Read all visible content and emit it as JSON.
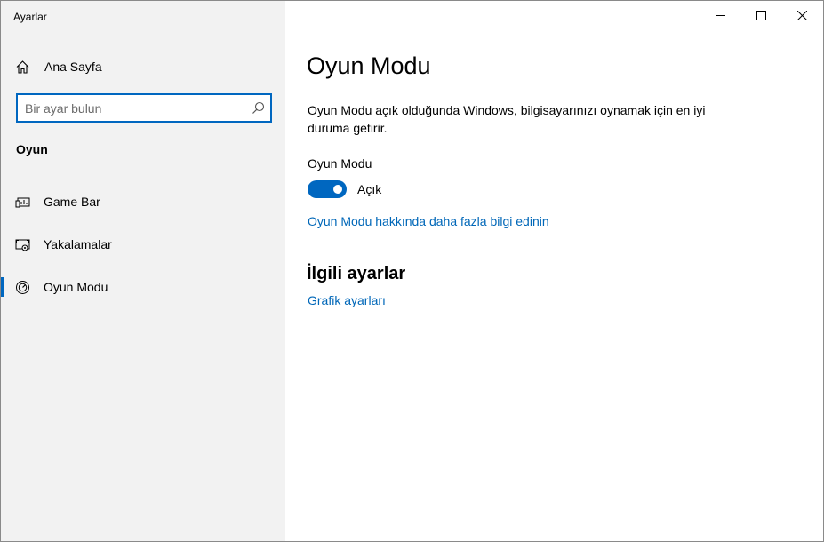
{
  "window": {
    "title": "Ayarlar",
    "controls": {
      "minimize": "minimize-icon",
      "maximize": "maximize-icon",
      "close": "close-icon"
    }
  },
  "sidebar": {
    "home_label": "Ana Sayfa",
    "search": {
      "placeholder": "Bir ayar bulun",
      "value": ""
    },
    "section_title": "Oyun",
    "items": [
      {
        "label": "Game Bar",
        "icon": "game-bar-icon",
        "active": false
      },
      {
        "label": "Yakalamalar",
        "icon": "captures-icon",
        "active": false
      },
      {
        "label": "Oyun Modu",
        "icon": "game-mode-icon",
        "active": true
      }
    ]
  },
  "main": {
    "title": "Oyun Modu",
    "description": "Oyun Modu açık olduğunda Windows, bilgisayarınızı oynamak için en iyi duruma getirir.",
    "setting_label": "Oyun Modu",
    "toggle": {
      "on": true,
      "state_label": "Açık"
    },
    "learn_more_link": "Oyun Modu hakkında daha fazla bilgi edinin",
    "related": {
      "title": "İlgili ayarlar",
      "links": [
        "Grafik ayarları"
      ]
    }
  },
  "colors": {
    "accent": "#0067c0",
    "link": "#0067b8",
    "sidebar_bg": "#f2f2f2"
  }
}
